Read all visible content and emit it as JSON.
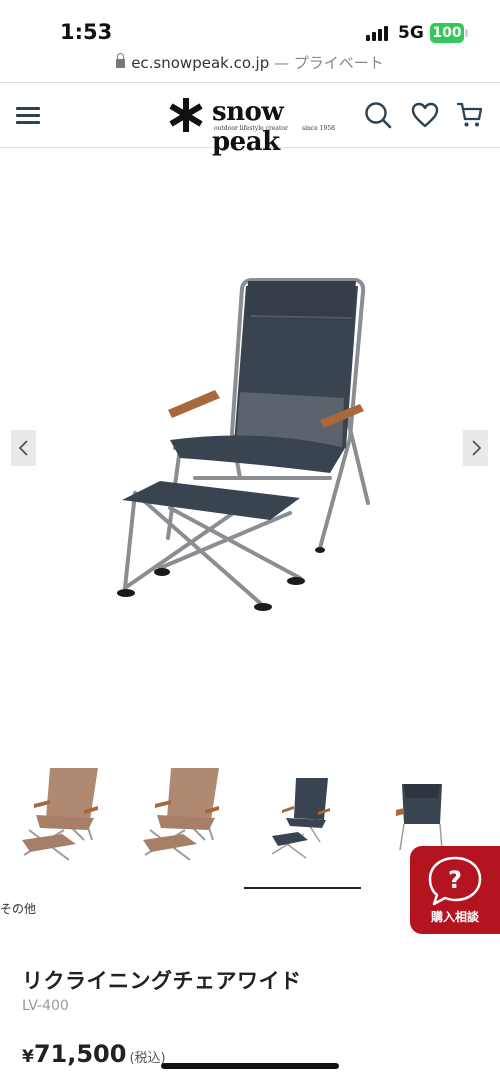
{
  "status_bar": {
    "time": "1:53",
    "network": "5G",
    "battery": "100"
  },
  "browser": {
    "url": "ec.snowpeak.co.jp",
    "separator": "—",
    "mode": "プライベート"
  },
  "header": {
    "logo_text": "snow peak",
    "logo_tagline": "outdoor lifestyle creator",
    "logo_since": "since 1958",
    "icons": [
      "menu-icon",
      "search-icon",
      "heart-icon",
      "cart-icon"
    ]
  },
  "gallery": {
    "prev_icon": "chevron-left-icon",
    "next_icon": "chevron-right-icon",
    "thumb_caption": "その他",
    "active_thumb_index": 2
  },
  "consult": {
    "label": "購入相談",
    "icon": "question-chat-icon"
  },
  "product": {
    "name": "リクライニングチェアワイド",
    "code": "LV-400",
    "currency": "¥",
    "price": "71,500",
    "tax_note": "(税込)"
  },
  "colors": {
    "accent_red": "#b3141f",
    "header_icon": "#2b4256",
    "chair_fabric": "#3a4450",
    "armrest_wood": "#a8683c",
    "beige_fabric": "#b08a70"
  }
}
